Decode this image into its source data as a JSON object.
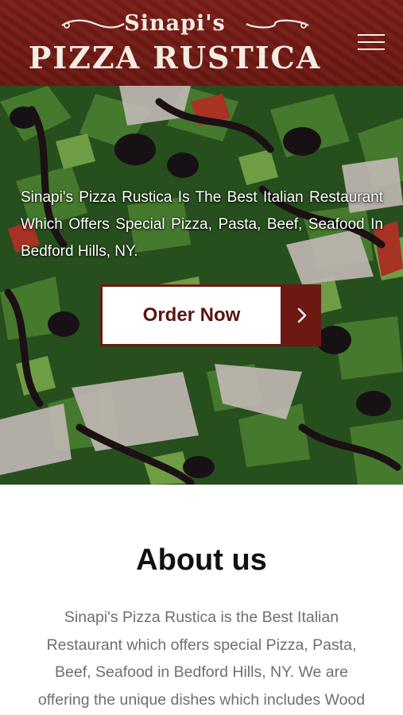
{
  "header": {
    "logo_subtitle": "Sinapi's",
    "logo_title": "PIZZA RUSTICA",
    "menu_icon": "hamburger-menu-icon",
    "bg_color": "#731a15"
  },
  "hero": {
    "tagline": "Sinapi's Pizza Rustica Is The Best Italian Restaurant Which Offers Special Pizza, Pasta, Beef, Seafood In Bedford Hills, NY.",
    "cta_label": "Order Now",
    "cta_icon": "chevron-right-icon",
    "accent_color": "#6d1813"
  },
  "about": {
    "title": "About us",
    "text": "Sinapi's Pizza Rustica is the Best Italian Restaurant which offers special Pizza, Pasta, Beef, Seafood in Bedford Hills, NY. We are offering the unique dishes which includes Wood"
  }
}
